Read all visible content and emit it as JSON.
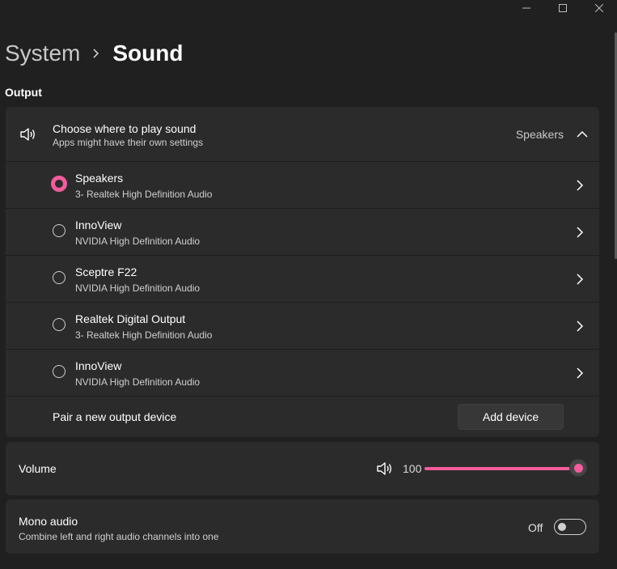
{
  "window": {
    "controls": [
      {
        "name": "minimize-icon"
      },
      {
        "name": "maximize-icon"
      },
      {
        "name": "close-icon"
      }
    ]
  },
  "breadcrumb": {
    "parent": "System",
    "current": "Sound"
  },
  "output": {
    "section_label": "Output",
    "header": {
      "title": "Choose where to play sound",
      "subtitle": "Apps might have their own settings",
      "value": "Speakers",
      "icon": "speaker-icon"
    },
    "devices": [
      {
        "name": "Speakers",
        "sub": "3- Realtek High Definition Audio",
        "selected": true
      },
      {
        "name": "InnoView",
        "sub": "NVIDIA High Definition Audio",
        "selected": false
      },
      {
        "name": "Sceptre F22",
        "sub": "NVIDIA High Definition Audio",
        "selected": false
      },
      {
        "name": "Realtek Digital Output",
        "sub": "3- Realtek High Definition Audio",
        "selected": false
      },
      {
        "name": "InnoView",
        "sub": "NVIDIA High Definition Audio",
        "selected": false
      }
    ],
    "pair": {
      "label": "Pair a new output device",
      "button": "Add device"
    }
  },
  "volume": {
    "label": "Volume",
    "value": "100",
    "level_percent": 100
  },
  "mono": {
    "title": "Mono audio",
    "subtitle": "Combine left and right audio channels into one",
    "state": "Off"
  },
  "colors": {
    "accent": "#f35c9b",
    "background": "#202020",
    "card": "#2b2b2b"
  }
}
